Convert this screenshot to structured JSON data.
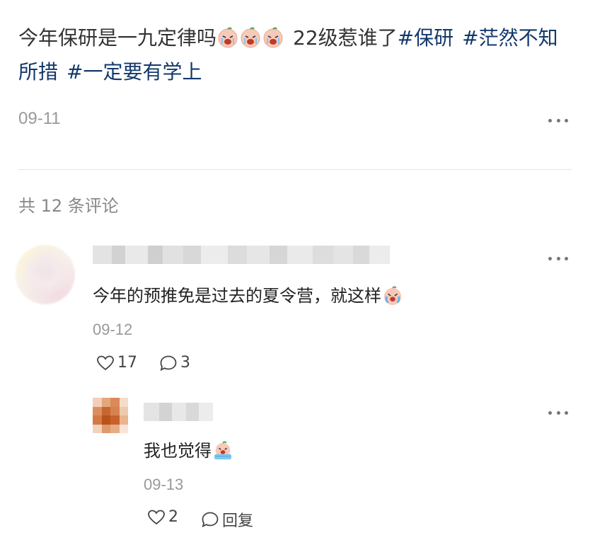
{
  "post": {
    "text_main": "今年保研是一九定律吗",
    "text_after_emoji": "22级惹谁了",
    "tags": [
      "#保研",
      "#茫然不知所措",
      "#一定要有学上"
    ],
    "emoji_name": "crying-face-emoji",
    "date": "09-11"
  },
  "comments_header": {
    "label": "共 12 条评论"
  },
  "comment1": {
    "text": "今年的预推免是过去的夏令营，就这样",
    "emoji_name": "crying-face-emoji",
    "date": "09-12",
    "likes": "17",
    "replies": "3"
  },
  "reply1": {
    "text": "我也觉得",
    "emoji_name": "crying-face-emoji",
    "date": "09-13",
    "likes": "2",
    "reply_label": "回复"
  },
  "colors": {
    "tag": "#13386c",
    "muted": "#999999",
    "text": "#333333"
  }
}
